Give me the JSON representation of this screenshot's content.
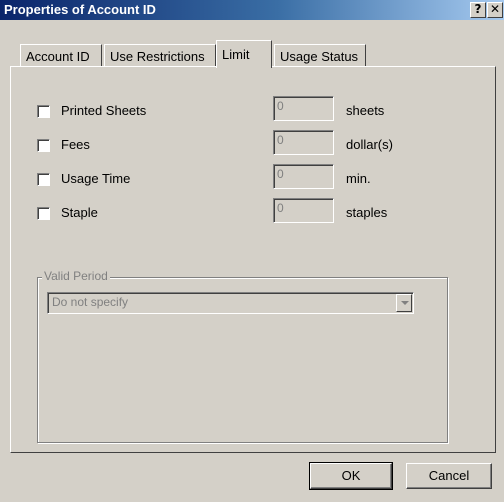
{
  "window": {
    "title": "Properties of Account ID",
    "help_glyph": "?",
    "close_glyph": "✕"
  },
  "tabs": [
    {
      "label": "Account ID",
      "active": false
    },
    {
      "label": "Use Restrictions",
      "active": false
    },
    {
      "label": "Limit",
      "active": true
    },
    {
      "label": "Usage Status",
      "active": false
    }
  ],
  "limits": [
    {
      "label": "Printed Sheets",
      "checked": false,
      "value": "0",
      "unit": "sheets"
    },
    {
      "label": "Fees",
      "checked": false,
      "value": "0",
      "unit": "dollar(s)"
    },
    {
      "label": "Usage Time",
      "checked": false,
      "value": "0",
      "unit": "min."
    },
    {
      "label": "Staple",
      "checked": false,
      "value": "0",
      "unit": "staples"
    }
  ],
  "valid_period": {
    "legend": "Valid Period",
    "selected": "Do not specify",
    "enabled": false
  },
  "buttons": {
    "ok": "OK",
    "cancel": "Cancel"
  }
}
